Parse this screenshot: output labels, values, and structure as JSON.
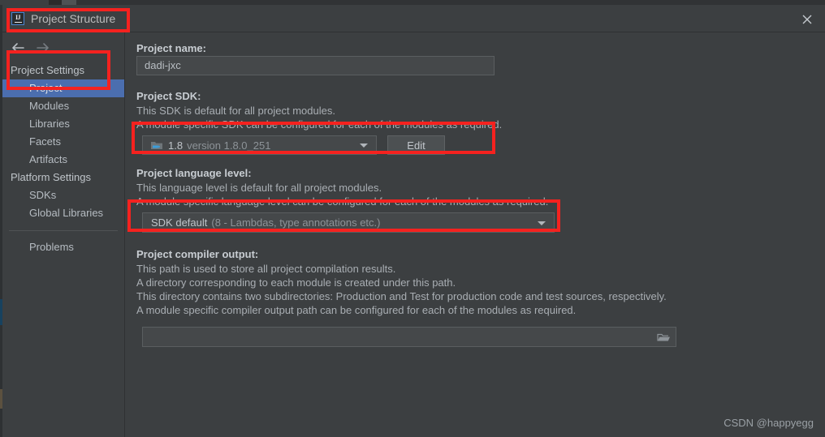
{
  "window": {
    "title": "Project Structure",
    "logo_icon": "intellij-idea-logo-icon",
    "close_icon": "close-icon",
    "back_icon": "arrow-left-icon",
    "forward_icon": "arrow-right-icon"
  },
  "sidebar": {
    "groups": [
      {
        "label": "Project Settings",
        "items": [
          {
            "label": "Project",
            "selected": true
          },
          {
            "label": "Modules",
            "selected": false
          },
          {
            "label": "Libraries",
            "selected": false
          },
          {
            "label": "Facets",
            "selected": false
          },
          {
            "label": "Artifacts",
            "selected": false
          }
        ]
      },
      {
        "label": "Platform Settings",
        "items": [
          {
            "label": "SDKs",
            "selected": false
          },
          {
            "label": "Global Libraries",
            "selected": false
          }
        ]
      }
    ],
    "problems": {
      "label": "Problems",
      "selected": false
    }
  },
  "main": {
    "project_name": {
      "label": "Project name:",
      "value": "dadi-jxc",
      "placeholder": ""
    },
    "project_sdk": {
      "label": "Project SDK:",
      "description": [
        "This SDK is default for all project modules.",
        "A module specific SDK can be configured for each of the modules as required."
      ],
      "selected_name": "1.8",
      "selected_detail": "version 1.8.0_251",
      "sdk_icon": "java-sdk-folder-icon",
      "dropdown_icon": "chevron-down-icon",
      "edit_button": "Edit"
    },
    "language_level": {
      "label": "Project language level:",
      "description": [
        "This language level is default for all project modules.",
        "A module specific language level can be configured for each of the modules as required."
      ],
      "selected_name": "SDK default",
      "selected_detail": "(8 - Lambdas, type annotations etc.)",
      "dropdown_icon": "chevron-down-icon"
    },
    "compiler_output": {
      "label": "Project compiler output:",
      "description": [
        "This path is used to store all project compilation results.",
        "A directory corresponding to each module is created under this path.",
        "This directory contains two subdirectories: Production and Test for production code and test sources, respectively.",
        "A module specific compiler output path can be configured for each of the modules as required."
      ],
      "value": "",
      "placeholder": "",
      "browse_icon": "folder-browse-icon"
    }
  },
  "annotations": {
    "color": "#f5221f",
    "boxes": [
      {
        "name": "title-highlight"
      },
      {
        "name": "project-nav-highlight"
      },
      {
        "name": "project-sdk-highlight"
      },
      {
        "name": "language-level-highlight"
      }
    ]
  },
  "watermark": {
    "text": "CSDN @happyegg"
  }
}
